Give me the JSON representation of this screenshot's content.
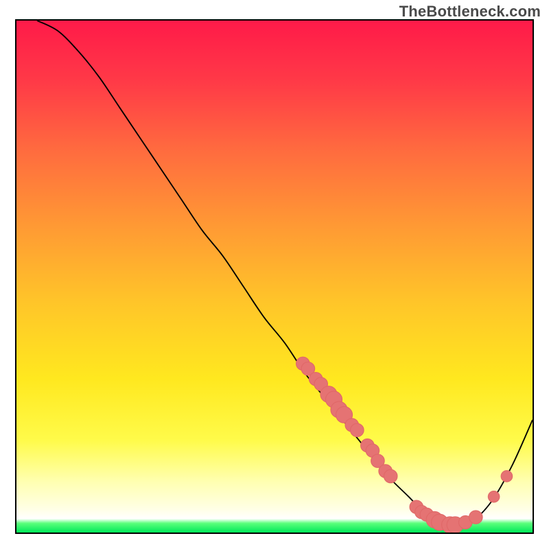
{
  "watermark": "TheBottleneck.com",
  "colors": {
    "border": "#000000",
    "gradient_stops": [
      {
        "offset": 0.0,
        "color": "#ff1a49"
      },
      {
        "offset": 0.12,
        "color": "#ff3a47"
      },
      {
        "offset": 0.25,
        "color": "#ff6a3f"
      },
      {
        "offset": 0.4,
        "color": "#ff9934"
      },
      {
        "offset": 0.55,
        "color": "#ffc529"
      },
      {
        "offset": 0.7,
        "color": "#ffe81f"
      },
      {
        "offset": 0.82,
        "color": "#fffb4a"
      },
      {
        "offset": 0.9,
        "color": "#ffffb0"
      },
      {
        "offset": 0.955,
        "color": "#ffffe6"
      },
      {
        "offset": 0.973,
        "color": "#ffffff"
      },
      {
        "offset": 0.982,
        "color": "#5aff7a"
      },
      {
        "offset": 1.0,
        "color": "#00e85a"
      }
    ],
    "curve": "#000000",
    "marker_fill": "#e57373",
    "marker_stroke": "#e06868"
  },
  "chart_data": {
    "type": "line",
    "title": "",
    "xlabel": "",
    "ylabel": "",
    "xlim": [
      0,
      100
    ],
    "ylim": [
      0,
      100
    ],
    "x": [
      4,
      8,
      12,
      16,
      20,
      24,
      28,
      32,
      36,
      40,
      44,
      48,
      52,
      56,
      60,
      64,
      68,
      72,
      76,
      80,
      84,
      88,
      92,
      96,
      100
    ],
    "values": [
      100,
      98,
      94,
      89,
      83,
      77,
      71,
      65,
      59,
      54,
      48,
      42,
      37,
      31,
      26,
      21,
      16,
      11,
      7,
      3,
      1,
      2,
      6,
      13,
      22
    ],
    "marker_points": [
      {
        "x": 55.5,
        "y": 33,
        "r": 1.3
      },
      {
        "x": 56.5,
        "y": 32,
        "r": 1.3
      },
      {
        "x": 58.0,
        "y": 30,
        "r": 1.3
      },
      {
        "x": 59.0,
        "y": 29,
        "r": 1.3
      },
      {
        "x": 60.5,
        "y": 27,
        "r": 1.6
      },
      {
        "x": 61.5,
        "y": 26,
        "r": 1.6
      },
      {
        "x": 62.5,
        "y": 24,
        "r": 1.6
      },
      {
        "x": 63.5,
        "y": 23,
        "r": 1.6
      },
      {
        "x": 65.0,
        "y": 21,
        "r": 1.3
      },
      {
        "x": 66.0,
        "y": 20,
        "r": 1.3
      },
      {
        "x": 68.0,
        "y": 17,
        "r": 1.3
      },
      {
        "x": 69.0,
        "y": 16,
        "r": 1.3
      },
      {
        "x": 70.0,
        "y": 14,
        "r": 1.3
      },
      {
        "x": 71.5,
        "y": 12,
        "r": 1.3
      },
      {
        "x": 72.5,
        "y": 11,
        "r": 1.3
      },
      {
        "x": 77.5,
        "y": 5,
        "r": 1.3
      },
      {
        "x": 78.5,
        "y": 4,
        "r": 1.3
      },
      {
        "x": 79.5,
        "y": 3.5,
        "r": 1.3
      },
      {
        "x": 81.0,
        "y": 2.5,
        "r": 1.6
      },
      {
        "x": 82.0,
        "y": 2,
        "r": 1.6
      },
      {
        "x": 84.0,
        "y": 1.5,
        "r": 1.6
      },
      {
        "x": 85.0,
        "y": 1.5,
        "r": 1.6
      },
      {
        "x": 87.0,
        "y": 2,
        "r": 1.3
      },
      {
        "x": 89.0,
        "y": 3,
        "r": 1.3
      },
      {
        "x": 92.5,
        "y": 7,
        "r": 1.1
      },
      {
        "x": 95.0,
        "y": 11,
        "r": 1.1
      }
    ]
  }
}
